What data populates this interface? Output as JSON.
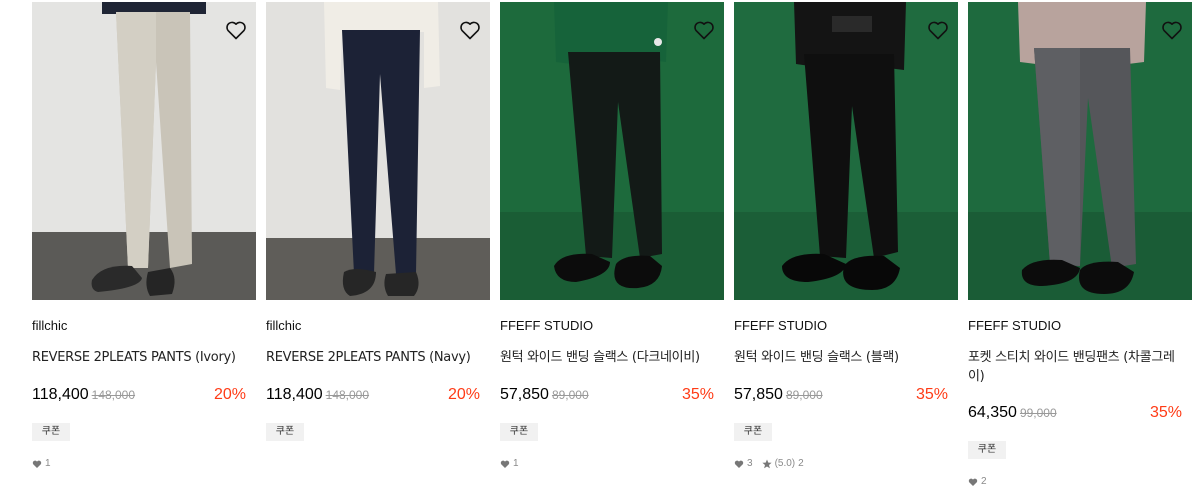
{
  "colors": {
    "discount": "#ff3b16",
    "strike": "#999999",
    "coupon_bg": "#f1f1f1"
  },
  "products": [
    {
      "brand": "fillchic",
      "name": "REVERSE 2PLEATS PANTS (Ivory)",
      "price": "118,400",
      "original_price": "148,000",
      "discount": "20%",
      "coupon": "쿠폰",
      "likes": "1",
      "rating": "",
      "reviews": ""
    },
    {
      "brand": "fillchic",
      "name": "REVERSE 2PLEATS PANTS (Navy)",
      "price": "118,400",
      "original_price": "148,000",
      "discount": "20%",
      "coupon": "쿠폰",
      "likes": "",
      "rating": "",
      "reviews": ""
    },
    {
      "brand": "FFEFF STUDIO",
      "name": "원턱 와이드 밴딩 슬랙스 (다크네이비)",
      "price": "57,850",
      "original_price": "89,000",
      "discount": "35%",
      "coupon": "쿠폰",
      "likes": "1",
      "rating": "",
      "reviews": ""
    },
    {
      "brand": "FFEFF STUDIO",
      "name": "원턱 와이드 밴딩 슬랙스 (블랙)",
      "price": "57,850",
      "original_price": "89,000",
      "discount": "35%",
      "coupon": "쿠폰",
      "likes": "3",
      "rating": "(5.0)",
      "reviews": "2"
    },
    {
      "brand": "FFEFF STUDIO",
      "name": "포켓 스티치 와이드 밴딩팬츠 (차콜그레이)",
      "price": "64,350",
      "original_price": "99,000",
      "discount": "35%",
      "coupon": "쿠폰",
      "likes": "2",
      "rating": "",
      "reviews": ""
    }
  ]
}
